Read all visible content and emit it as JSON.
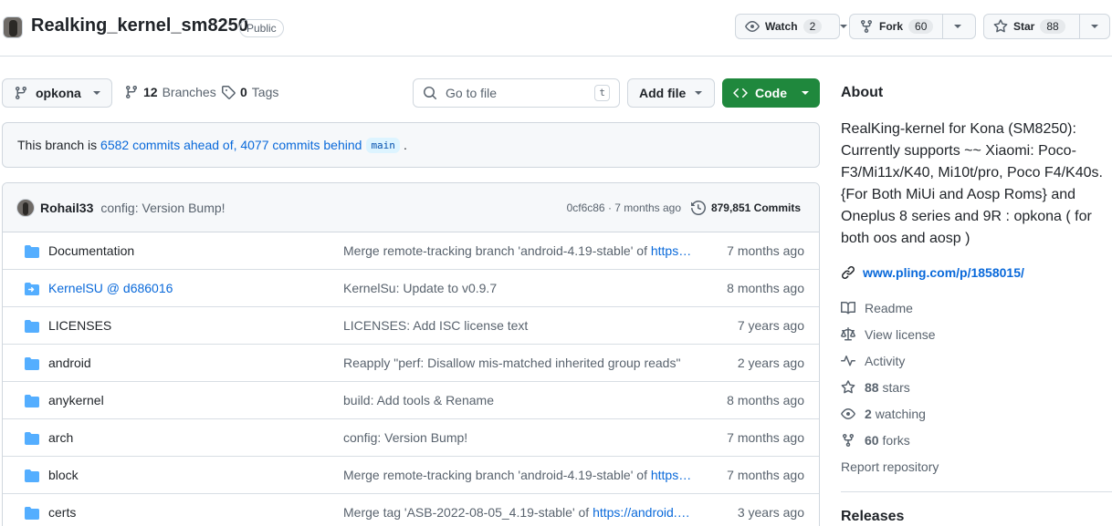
{
  "header": {
    "repo_name": "Realking_kernel_sm8250",
    "visibility": "Public",
    "watch": {
      "label": "Watch",
      "count": "2"
    },
    "fork": {
      "label": "Fork",
      "count": "60"
    },
    "star": {
      "label": "Star",
      "count": "88"
    }
  },
  "toolbar": {
    "branch": "opkona",
    "branches_count": "12",
    "branches_label": "Branches",
    "tags_count": "0",
    "tags_label": "Tags",
    "search_placeholder": "Go to file",
    "search_shortcut": "t",
    "add_file": "Add file",
    "code": "Code"
  },
  "branch_info": {
    "prefix": "This branch is",
    "link": "6582 commits ahead of, 4077 commits behind",
    "base": "main",
    "suffix": "."
  },
  "latest_commit": {
    "author": "Rohail33",
    "message": "config: Version Bump!",
    "sha_time": "0cf6c86 · 7 months ago",
    "commits": "879,851 Commits"
  },
  "files": [
    {
      "name": "Documentation",
      "type": "dir",
      "msg": "Merge remote-tracking branch 'android-4.19-stable' of ",
      "msg_link": "https…",
      "age": "7 months ago"
    },
    {
      "name": "KernelSU @ d686016",
      "type": "submodule",
      "msg": "KernelSu: Update to v0.9.7",
      "msg_link": "",
      "age": "8 months ago"
    },
    {
      "name": "LICENSES",
      "type": "dir",
      "msg": "LICENSES: Add ISC license text",
      "msg_link": "",
      "age": "7 years ago"
    },
    {
      "name": "android",
      "type": "dir",
      "msg": "Reapply \"perf: Disallow mis-matched inherited group reads\"",
      "msg_link": "",
      "age": "2 years ago"
    },
    {
      "name": "anykernel",
      "type": "dir",
      "msg": "build: Add tools & Rename",
      "msg_link": "",
      "age": "8 months ago"
    },
    {
      "name": "arch",
      "type": "dir",
      "msg": "config: Version Bump!",
      "msg_link": "",
      "age": "7 months ago"
    },
    {
      "name": "block",
      "type": "dir",
      "msg": "Merge remote-tracking branch 'android-4.19-stable' of ",
      "msg_link": "https…",
      "age": "7 months ago"
    },
    {
      "name": "certs",
      "type": "dir",
      "msg": "Merge tag 'ASB-2022-08-05_4.19-stable' of ",
      "msg_link": "https://android.…",
      "age": "3 years ago"
    }
  ],
  "about": {
    "heading": "About",
    "description": "RealKing-kernel for Kona (SM8250): Currently supports ~~ Xiaomi: Poco-F3/Mi11x/K40, Mi10t/pro, Poco F4/K40s. {For Both MiUi and Aosp Roms} and Oneplus 8 series and 9R : opkona ( for both oos and aosp )",
    "website": "www.pling.com/p/1858015/",
    "readme": "Readme",
    "license": "View license",
    "activity": "Activity",
    "stars_count": "88",
    "stars_label": "stars",
    "watching_count": "2",
    "watching_label": "watching",
    "forks_count": "60",
    "forks_label": "forks",
    "report": "Report repository"
  },
  "releases": {
    "heading": "Releases"
  },
  "colors": {
    "primary_button": "#1f883d",
    "link": "#0969da",
    "folder": "#54aeff"
  },
  "icons": [
    "repo-avatar",
    "eye-icon",
    "repo-forked-icon",
    "star-icon",
    "git-branch-icon",
    "tag-icon",
    "search-icon",
    "code-icon",
    "history-icon",
    "file-directory-icon",
    "file-submodule-icon",
    "link-icon",
    "book-icon",
    "law-icon",
    "pulse-icon"
  ]
}
